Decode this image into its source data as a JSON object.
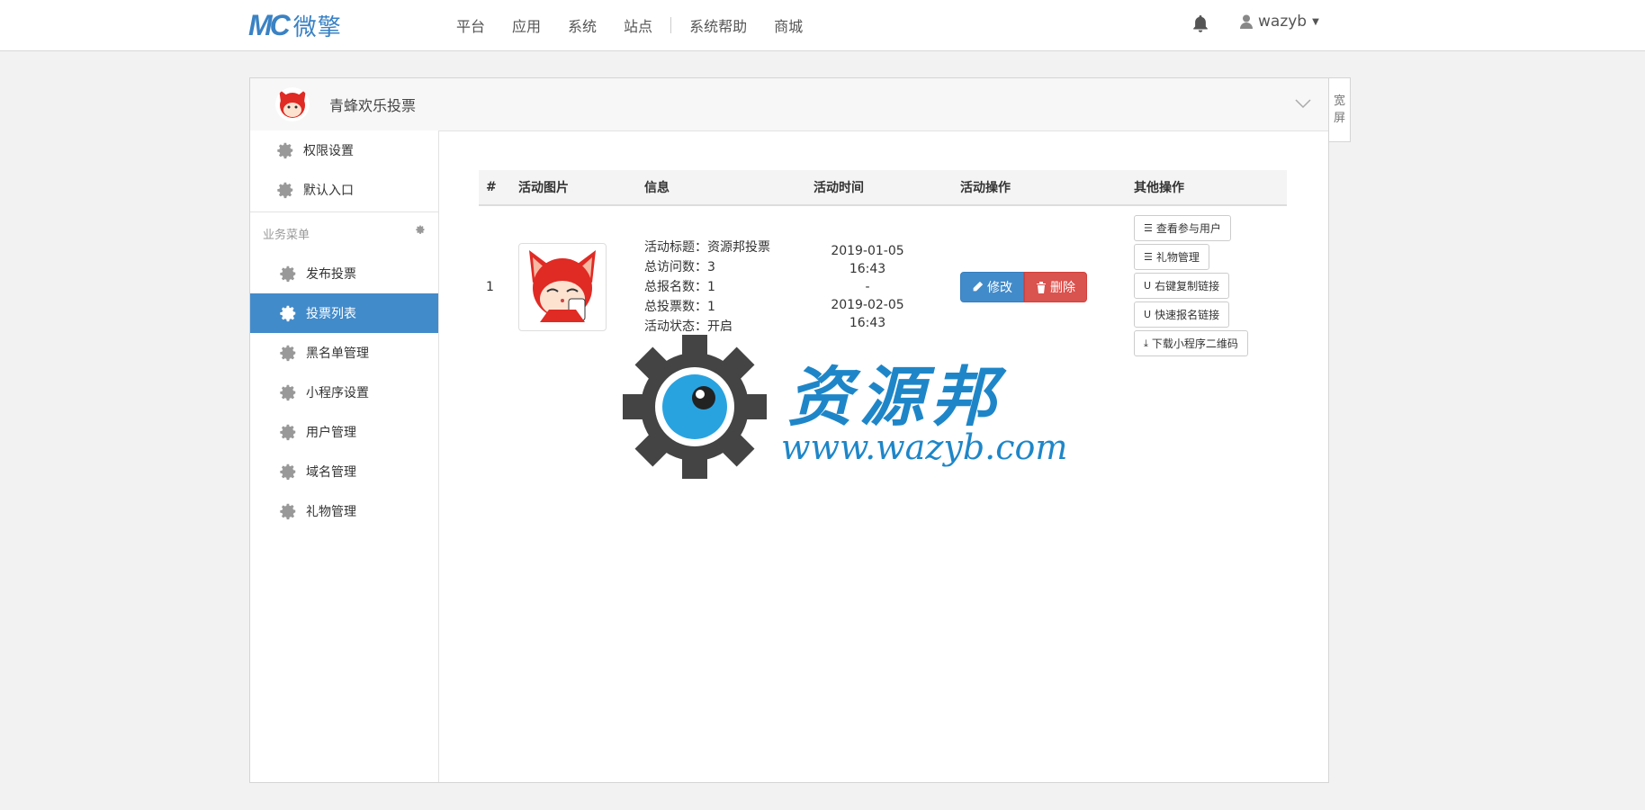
{
  "header": {
    "logo_mark": "MC",
    "logo_name": "微擎",
    "nav": [
      "平台",
      "应用",
      "系统",
      "站点",
      "系统帮助",
      "商城"
    ],
    "user": "wazyb"
  },
  "panel": {
    "title": "青蜂欢乐投票",
    "wide_screen": [
      "宽",
      "屏"
    ]
  },
  "sidebar": {
    "top_items": [
      "权限设置",
      "默认入口"
    ],
    "section_label": "业务菜单",
    "items": [
      "发布投票",
      "投票列表",
      "黑名单管理",
      "小程序设置",
      "用户管理",
      "域名管理",
      "礼物管理"
    ],
    "active_index": 1
  },
  "table": {
    "headers": [
      "#",
      "活动图片",
      "信息",
      "活动时间",
      "活动操作",
      "其他操作"
    ],
    "rows": [
      {
        "index": "1",
        "info": [
          "活动标题：资源邦投票",
          "总访问数：3",
          "总报名数：1",
          "总投票数：1",
          "活动状态：开启"
        ],
        "time_start": "2019-01-05 16:43",
        "time_sep": "-",
        "time_end": "2019-02-05 16:43",
        "edit_label": "修改",
        "delete_label": "删除",
        "other_actions": [
          "查看参与用户",
          "礼物管理",
          "右键复制链接",
          "快速报名链接",
          "下载小程序二维码"
        ]
      }
    ]
  },
  "watermark": {
    "cn": "资源邦",
    "url": "www.wazyb.com"
  },
  "colors": {
    "primary": "#428bca",
    "danger": "#d9534f",
    "brand": "#3a82c4"
  }
}
